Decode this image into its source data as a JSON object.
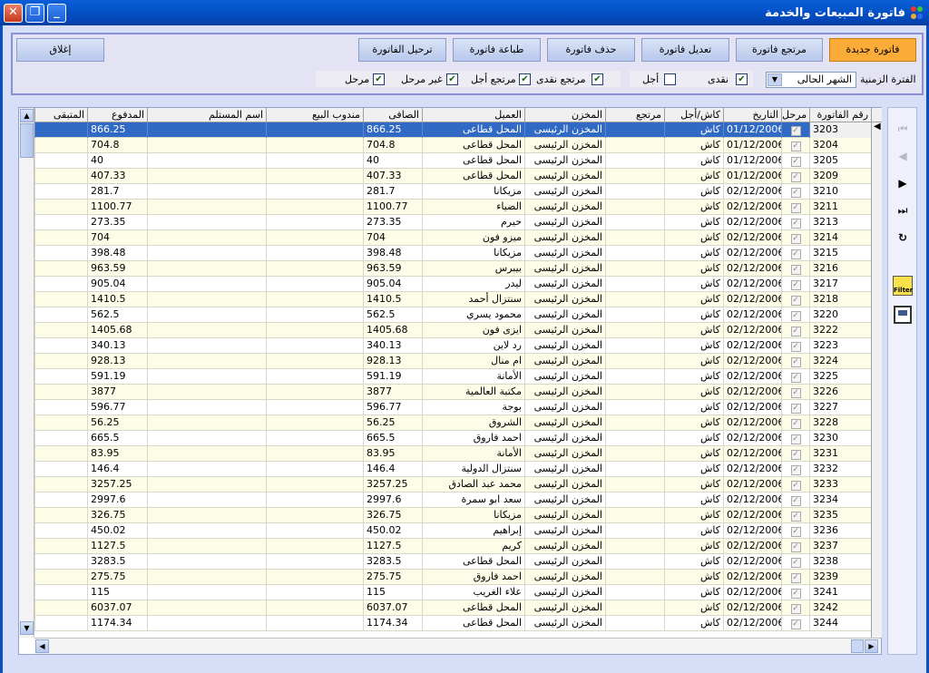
{
  "window": {
    "title": "فاتورة المبيعات والخدمة"
  },
  "toolbar": {
    "new_invoice": "فاتورة جديدة",
    "return_invoice": "مرتجع فاتورة",
    "edit_invoice": "تعديل فاتورة",
    "delete_invoice": "حذف فاتورة",
    "print_invoice": "طباعة فاتورة",
    "post_invoice": "ترحيل الفاتورة",
    "close": "إغلاق"
  },
  "filters": {
    "period_label": "الفترة الزمنية",
    "period_value": "الشهر الحالى",
    "cash": {
      "label": "نقدى",
      "checked": true
    },
    "credit": {
      "label": "أجل",
      "checked": false
    },
    "cash_return": {
      "label": "مرتجع نقدى",
      "checked": true
    },
    "credit_return": {
      "label": "مرتجع أجل",
      "checked": true
    },
    "not_posted": {
      "label": "غير مرحل",
      "checked": true
    },
    "posted": {
      "label": "مرحل",
      "checked": true
    }
  },
  "grid": {
    "columns": {
      "invoice_no": "رقم الفاتورة",
      "posted": "مرحل",
      "date": "التاريخ",
      "payment": "كاش/أجل",
      "returned": "مرتجع",
      "store": "المخزن",
      "customer": "العميل",
      "net": "الصافى",
      "sales_rep": "مندوب البيع",
      "receiver": "اسم المستلم",
      "paid": "المدفوع",
      "remaining": "المتبقى"
    },
    "rows": [
      {
        "no": "3203",
        "date": "01/12/2006",
        "pay": "كاش",
        "store": "المخزن الرئيسى",
        "customer": "المحل قطاعى",
        "net": "866.25",
        "paid": "866.25"
      },
      {
        "no": "3204",
        "date": "01/12/2006",
        "pay": "كاش",
        "store": "المخزن الرئيسى",
        "customer": "المحل قطاعى",
        "net": "704.8",
        "paid": "704.8"
      },
      {
        "no": "3205",
        "date": "01/12/2006",
        "pay": "كاش",
        "store": "المخزن الرئيسى",
        "customer": "المحل قطاعى",
        "net": "40",
        "paid": "40"
      },
      {
        "no": "3209",
        "date": "01/12/2006",
        "pay": "كاش",
        "store": "المخزن الرئيسى",
        "customer": "المحل قطاعى",
        "net": "407.33",
        "paid": "407.33"
      },
      {
        "no": "3210",
        "date": "02/12/2006",
        "pay": "كاش",
        "store": "المخزن الرئيسى",
        "customer": "مزيكانا",
        "net": "281.7",
        "paid": "281.7"
      },
      {
        "no": "3211",
        "date": "02/12/2006",
        "pay": "كاش",
        "store": "المخزن الرئيسى",
        "customer": "الضياء",
        "net": "1100.77",
        "paid": "1100.77"
      },
      {
        "no": "3213",
        "date": "02/12/2006",
        "pay": "كاش",
        "store": "المخزن الرئيسى",
        "customer": "حيرم",
        "net": "273.35",
        "paid": "273.35"
      },
      {
        "no": "3214",
        "date": "02/12/2006",
        "pay": "كاش",
        "store": "المخزن الرئيسى",
        "customer": "ميزو فون",
        "net": "704",
        "paid": "704"
      },
      {
        "no": "3215",
        "date": "02/12/2006",
        "pay": "كاش",
        "store": "المخزن الرئيسى",
        "customer": "مزيكانا",
        "net": "398.48",
        "paid": "398.48"
      },
      {
        "no": "3216",
        "date": "02/12/2006",
        "pay": "كاش",
        "store": "المخزن الرئيسى",
        "customer": "بيبرس",
        "net": "963.59",
        "paid": "963.59"
      },
      {
        "no": "3217",
        "date": "02/12/2006",
        "pay": "كاش",
        "store": "المخزن الرئيسى",
        "customer": "ليدر",
        "net": "905.04",
        "paid": "905.04"
      },
      {
        "no": "3218",
        "date": "02/12/2006",
        "pay": "كاش",
        "store": "المخزن الرئيسى",
        "customer": "سنتزال أحمد",
        "net": "1410.5",
        "paid": "1410.5"
      },
      {
        "no": "3220",
        "date": "02/12/2006",
        "pay": "كاش",
        "store": "المخزن الرئيسى",
        "customer": "محمود يسري",
        "net": "562.5",
        "paid": "562.5"
      },
      {
        "no": "3222",
        "date": "02/12/2006",
        "pay": "كاش",
        "store": "المخزن الرئيسى",
        "customer": "ايزى فون",
        "net": "1405.68",
        "paid": "1405.68"
      },
      {
        "no": "3223",
        "date": "02/12/2006",
        "pay": "كاش",
        "store": "المخزن الرئيسى",
        "customer": "رد لاين",
        "net": "340.13",
        "paid": "340.13"
      },
      {
        "no": "3224",
        "date": "02/12/2006",
        "pay": "كاش",
        "store": "المخزن الرئيسى",
        "customer": "ام منال",
        "net": "928.13",
        "paid": "928.13"
      },
      {
        "no": "3225",
        "date": "02/12/2006",
        "pay": "كاش",
        "store": "المخزن الرئيسى",
        "customer": "الأمانة",
        "net": "591.19",
        "paid": "591.19"
      },
      {
        "no": "3226",
        "date": "02/12/2006",
        "pay": "كاش",
        "store": "المخزن الرئيسى",
        "customer": "مكتبة العالمية",
        "net": "3877",
        "paid": "3877"
      },
      {
        "no": "3227",
        "date": "02/12/2006",
        "pay": "كاش",
        "store": "المخزن الرئيسى",
        "customer": "بوجة",
        "net": "596.77",
        "paid": "596.77"
      },
      {
        "no": "3228",
        "date": "02/12/2006",
        "pay": "كاش",
        "store": "المخزن الرئيسى",
        "customer": "الشروق",
        "net": "56.25",
        "paid": "56.25"
      },
      {
        "no": "3230",
        "date": "02/12/2006",
        "pay": "كاش",
        "store": "المخزن الرئيسى",
        "customer": "احمد فاروق",
        "net": "665.5",
        "paid": "665.5"
      },
      {
        "no": "3231",
        "date": "02/12/2006",
        "pay": "كاش",
        "store": "المخزن الرئيسى",
        "customer": "الأمانة",
        "net": "83.95",
        "paid": "83.95"
      },
      {
        "no": "3232",
        "date": "02/12/2006",
        "pay": "كاش",
        "store": "المخزن الرئيسى",
        "customer": "سنتزال الدولية",
        "net": "146.4",
        "paid": "146.4"
      },
      {
        "no": "3233",
        "date": "02/12/2006",
        "pay": "كاش",
        "store": "المخزن الرئيسى",
        "customer": "محمد عبد الصادق",
        "net": "3257.25",
        "paid": "3257.25"
      },
      {
        "no": "3234",
        "date": "02/12/2006",
        "pay": "كاش",
        "store": "المخزن الرئيسى",
        "customer": "سعد ابو سمرة",
        "net": "2997.6",
        "paid": "2997.6"
      },
      {
        "no": "3235",
        "date": "02/12/2006",
        "pay": "كاش",
        "store": "المخزن الرئيسى",
        "customer": "مزيكانا",
        "net": "326.75",
        "paid": "326.75"
      },
      {
        "no": "3236",
        "date": "02/12/2006",
        "pay": "كاش",
        "store": "المخزن الرئيسى",
        "customer": "إبراهيم",
        "net": "450.02",
        "paid": "450.02"
      },
      {
        "no": "3237",
        "date": "02/12/2006",
        "pay": "كاش",
        "store": "المخزن الرئيسى",
        "customer": "كريم",
        "net": "1127.5",
        "paid": "1127.5"
      },
      {
        "no": "3238",
        "date": "02/12/2006",
        "pay": "كاش",
        "store": "المخزن الرئيسى",
        "customer": "المحل قطاعى",
        "net": "3283.5",
        "paid": "3283.5"
      },
      {
        "no": "3239",
        "date": "02/12/2006",
        "pay": "كاش",
        "store": "المخزن الرئيسى",
        "customer": "احمد فاروق",
        "net": "275.75",
        "paid": "275.75"
      },
      {
        "no": "3241",
        "date": "02/12/2006",
        "pay": "كاش",
        "store": "المخزن الرئيسى",
        "customer": "علاء الغريب",
        "net": "115",
        "paid": "115"
      },
      {
        "no": "3242",
        "date": "02/12/2006",
        "pay": "كاش",
        "store": "المخزن الرئيسى",
        "customer": "المحل قطاعى",
        "net": "6037.07",
        "paid": "6037.07"
      },
      {
        "no": "3244",
        "date": "02/12/2006",
        "pay": "كاش",
        "store": "المخزن الرئيسى",
        "customer": "المحل قطاعى",
        "net": "1174.34",
        "paid": "1174.34"
      }
    ]
  },
  "sidebar": {
    "first": "first-record-icon",
    "prev": "previous-record-icon",
    "next": "next-record-icon",
    "last": "last-record-icon",
    "refresh": "refresh-icon",
    "filter_label": "Filter",
    "save": "save-icon"
  },
  "colors": {
    "selected_row": "#316ac5",
    "alt_row": "#fdfce6",
    "accent_button": "#fbab38",
    "titlebar": "#0553c8"
  }
}
